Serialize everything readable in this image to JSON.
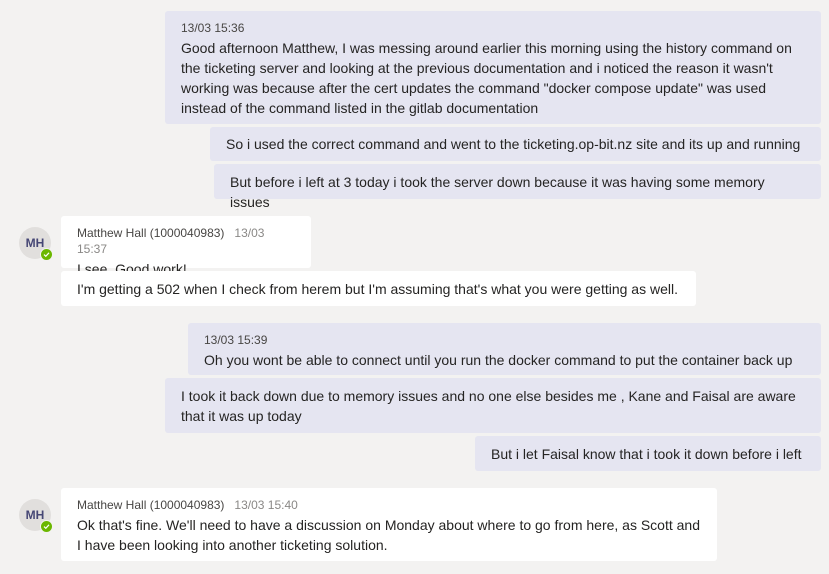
{
  "messages": {
    "out1": {
      "timestamp": "13/03 15:36",
      "text": "Good afternoon Matthew, I was messing around earlier this morning using the history command on the ticketing server and looking at the previous documentation and i noticed the reason it wasn't working was because after the cert updates the command \"docker compose update\" was used instead of the command listed in the gitlab documentation"
    },
    "out2": {
      "text": "So i used the correct command and went to the ticketing.op-bit.nz site and its up and running"
    },
    "out3": {
      "text": "But before i left at 3 today i took the server down because it was having some memory issues"
    },
    "in1": {
      "avatar": "MH",
      "sender": "Matthew Hall (1000040983)",
      "timestamp": "13/03 15:37",
      "text": "I see. Good work!"
    },
    "in2": {
      "text": "I'm getting a 502 when I check from herem but I'm assuming that's what you were getting as well."
    },
    "out4": {
      "timestamp": "13/03 15:39",
      "text": "Oh you wont be able to connect until you run the docker command to put the container back up"
    },
    "out5": {
      "text": "I took it back down due to memory issues and no one else besides me , Kane and Faisal are aware that it was up today"
    },
    "out6": {
      "text": "But i let Faisal know that i took it down before i left"
    },
    "in3": {
      "avatar": "MH",
      "sender": "Matthew Hall (1000040983)",
      "timestamp": "13/03 15:40",
      "text": "Ok that's fine. We'll need to have a discussion on Monday about where to go from here, as Scott and I have been looking into another ticketing solution."
    }
  },
  "colors": {
    "outgoing_bubble": "#e5e5f1",
    "incoming_bubble": "#ffffff",
    "background": "#f3f2f1",
    "presence_available": "#6bb700"
  }
}
